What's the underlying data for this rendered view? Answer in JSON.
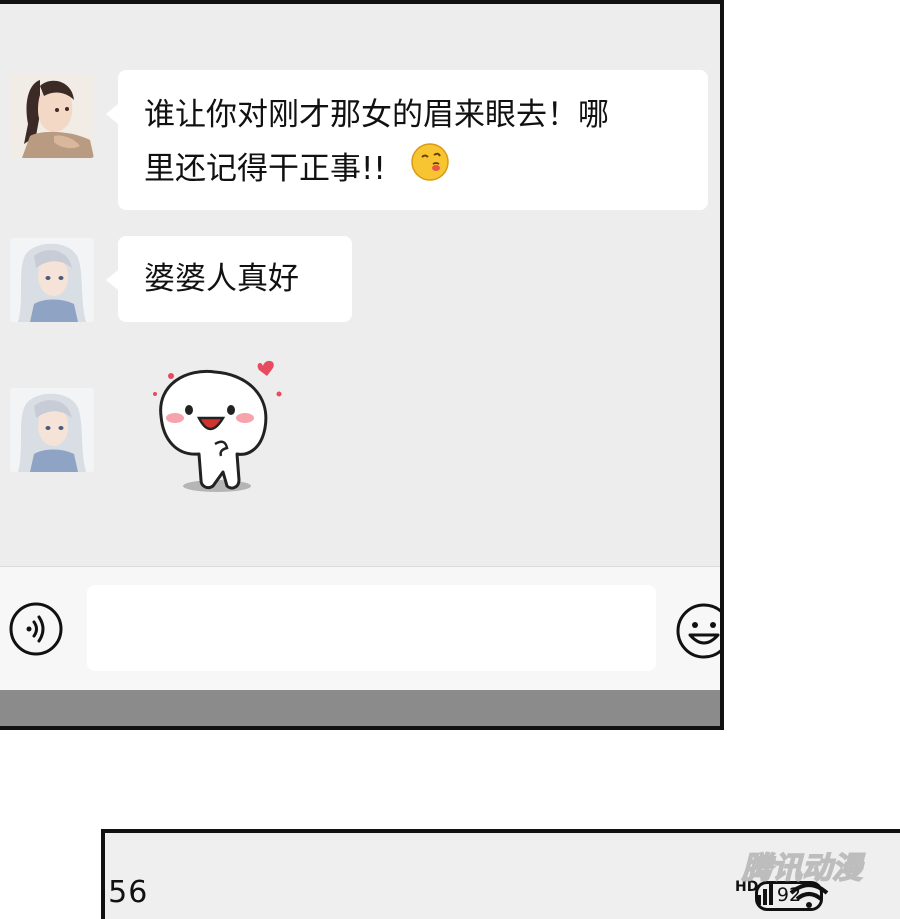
{
  "chat": {
    "messages": [
      {
        "sender": "female-character",
        "text_line1": "谁让你对刚才那女的眉来眼去！哪",
        "text_line2": "里还记得干正事!!",
        "emoji": "pouting-face-icon"
      },
      {
        "sender": "white-haired-character",
        "text": "婆婆人真好"
      },
      {
        "sender": "white-haired-character",
        "sticker": "blushing-blob-sticker"
      }
    ]
  },
  "input_bar": {
    "voice_icon": "voice-icon",
    "input_value": "",
    "emoji_icon": "smiley-icon"
  },
  "status_bar": {
    "time": ":56",
    "network": "HD",
    "battery": "92"
  },
  "watermark": {
    "text": "腾讯动漫"
  },
  "colors": {
    "chat_background": "#ededed",
    "bubble": "#ffffff",
    "input_bar": "#f7f7f7",
    "bottom_strip": "#8b8b8b",
    "panel_border": "#111111"
  }
}
